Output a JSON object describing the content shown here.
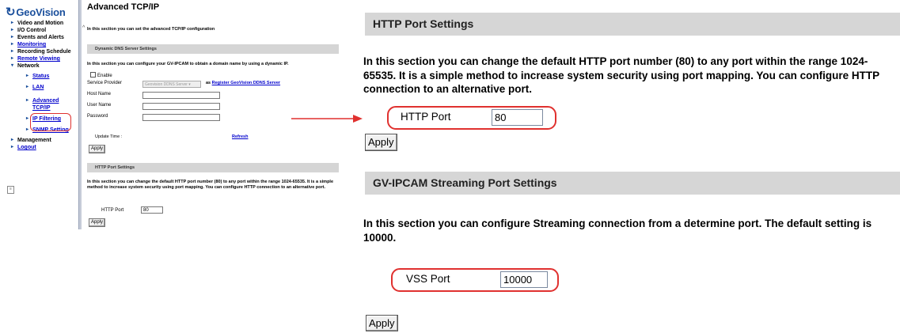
{
  "mini": {
    "logo": "GeoVision",
    "nav": {
      "items": [
        {
          "label": "Video and Motion",
          "link": false
        },
        {
          "label": "I/O Control",
          "link": false
        },
        {
          "label": "Events and Alerts",
          "link": false
        },
        {
          "label": "Monitoring",
          "link": true
        },
        {
          "label": "Recording Schedule",
          "link": false
        },
        {
          "label": "Remote Viewing",
          "link": true
        },
        {
          "label": "Network",
          "link": false
        }
      ],
      "sub_items": [
        {
          "label": "Status"
        },
        {
          "label": "LAN"
        },
        {
          "label": "Advanced TCP/IP"
        },
        {
          "label": "IP Filtering"
        },
        {
          "label": "SNMP Setting"
        }
      ],
      "bottom_items": [
        {
          "label": "Management",
          "link": false
        },
        {
          "label": "Logout",
          "link": true
        }
      ]
    },
    "content": {
      "title": "Advanced TCP/IP",
      "intro": "In this section you can set the advanced TCP/IP configuration",
      "dns_band": "Dynamic DNS Server Settings",
      "dns_desc": "In this section you can configure your GV-IPCAM to obtain a domain name by using a dynamic IP.",
      "enable_label": "Enable",
      "service_provider_label": "Service Provider",
      "service_provider_value": "Geovision DDNS Server",
      "as_text": "as",
      "register_link": "Register GeoVision DDNS Server",
      "host_name_label": "Host Name",
      "user_name_label": "User Name",
      "password_label": "Password",
      "update_time_label": "Update Time :",
      "refresh_link": "Refresh",
      "apply_label": "Apply",
      "http_band": "HTTP Port Settings",
      "http_desc": "In this section you can change the default HTTP port number (80) to any port within the range 1024-65535. It is a simple method to increase system security using port mapping. You can configure HTTP connection to an alternative port.",
      "http_port_label": "HTTP Port",
      "http_port_value": "80"
    }
  },
  "zoom": {
    "http_band": "HTTP Port Settings",
    "http_desc": "In this section you can change the default HTTP port number (80) to any port within the range 1024-65535. It is a simple method to increase system security using port mapping. You can configure HTTP connection to an alternative port.",
    "http_port_label": "HTTP Port",
    "http_port_value": "80",
    "apply_label": "Apply",
    "gv_band": "GV-IPCAM Streaming Port Settings",
    "gv_desc": "In this section you can configure Streaming connection from a determine port. The default setting is 10000.",
    "vss_port_label": "VSS Port",
    "vss_port_value": "10000",
    "apply2_label": "Apply"
  },
  "colors": {
    "highlight": "#e0312f",
    "band": "#d6d6d6",
    "link": "#0000cc",
    "brand": "#1a4f9c"
  }
}
